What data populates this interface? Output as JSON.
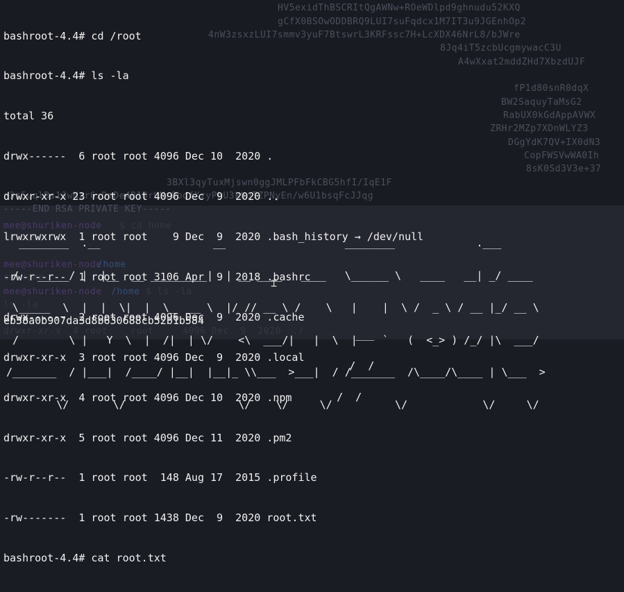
{
  "terminal": {
    "output_lines": [
      "bashroot-4.4# cd /root",
      "bashroot-4.4# ls -la",
      "total 36",
      "drwx------  6 root root 4096 Dec 10  2020 .",
      "drwxr-xr-x 23 root root 4096 Dec  9  2020 ..",
      "lrwxrwxrwx  1 root root    9 Dec  9  2020 .bash_history → /dev/null",
      "-rw-r--r--  1 root root 3106 Apr  9  2018 .bashrc",
      "drwx------  2 root root 4096 Dec  9  2020 .cache",
      "drwxr-xr-x  3 root root 4096 Dec  9  2020 .local",
      "drwxr-xr-x  4 root root 4096 Dec 10  2020 .npm",
      "drwxr-xr-x  5 root root 4096 Dec 11  2020 .pm2",
      "-rw-r--r--  1 root root  148 Aug 17  2015 .profile",
      "-rw-------  1 root root 1438 Dec  9  2020 root.txt",
      "bashroot-4.4# cat root.txt"
    ],
    "ascii_art": [
      "   ________  .__                  __                   ________             .___         ",
      "  /   _____/ |  |__  __ _________|  | __ ____   ____   \\______ \\   ____   __| _/ ____   ",
      "  \\_____  \\  |  |  \\|  |  \\_  __ \\  |/ // __ \\ /    \\   |    |  \\ /  _ \\ / __ |_/ __ \\  ",
      "  /        \\ |   Y  \\  |  /|  | \\/    <\\  ___/|   |  \\  |    `   (  <_> ) /_/ |\\  ___/  ",
      " /_______  / |___|  /____/ |__|  |__|_ \\\\___  >___|  / /_______  /\\____/\\____ | \\___  > ",
      "         \\/       \\/                  \\/    \\/     \\/          \\/            \\/     \\/  "
    ],
    "hash": "eb38a0b907da3d8b630688cb52b1b584",
    "slash_art": [
      "      ___",
      "     /  /",
      "   /  /"
    ],
    "ghost_text": {
      "key_lines": [
        "HV5exidThBSCRItQgAWNw+ROeWDlpd9ghnudu52KXQ",
        "gCfX0BSOwODDBRQ9LUI7suFqdcx1M7IT3u9JGEnhOp2",
        "4nW3zsxzLUI7smmv3yuF7BtswrL3KRFssc7H+LcXDX46NrL8/bJWre",
        "8Jq4iT5zcbUcgmywacC3U",
        "A4wXxat2mddZHd7XbzdUJF",
        "fP1d80snR0dqX",
        "BW2SaquyTaMsG2",
        "RabUX0kGdAppAVWX",
        "ZRHr2MZp7XDnWLYZ3",
        "DGgYdK7QV+IX0dN3",
        "CopFWSVwWA0Ih",
        "8sK0Sd3V3e+37",
        "3BXl3qyTuxMjswn0ggJMLPFbFkCBG5hfI/IqE1F",
        "n3z5uqlBs13wNzr6xDmDe4B1DrUNrObdfXzyPhU3kkqTZPNyEn/w6U1bsqFcJJqg"
      ],
      "end_key": "-----END RSA PRIVATE KEY-----",
      "prompt_user": "mee@shuriken-node",
      "prompt_path": "/home",
      "cd_cmd": "$ cd home",
      "cd_home": "cd home",
      "ls_cmd": "$ ls -la",
      "ls_la": "ls -la",
      "dir_line": "drwxr-xr-x  4 root    root     4096 Dec  9  2020  ./"
    }
  }
}
